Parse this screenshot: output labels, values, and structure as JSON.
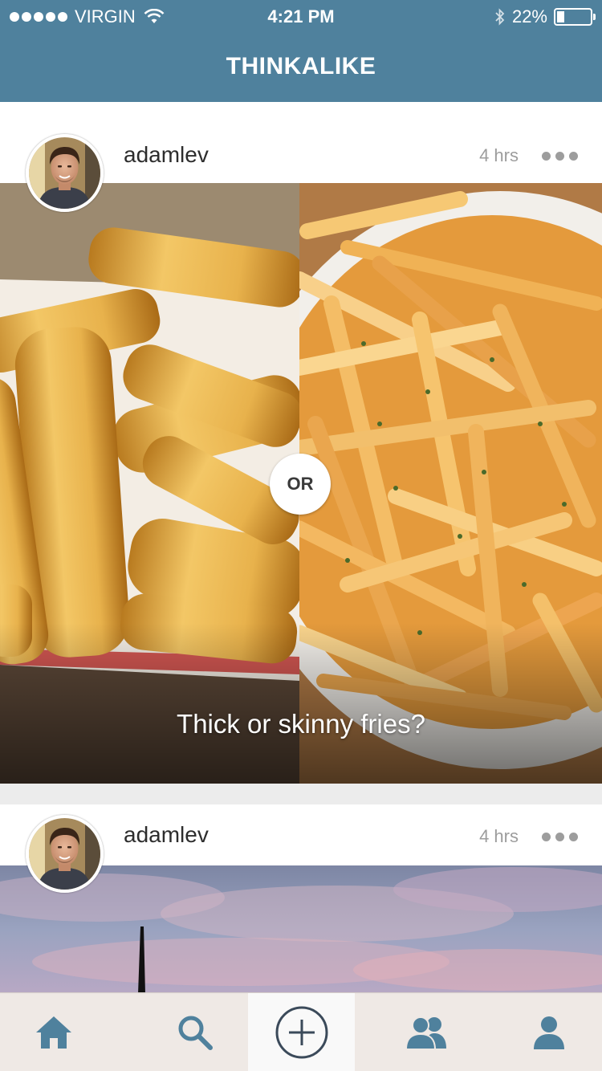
{
  "status_bar": {
    "carrier": "VIRGIN",
    "time": "4:21 PM",
    "battery": "22%",
    "battery_level": 0.22
  },
  "header": {
    "title": "THINKALIKE"
  },
  "posts": [
    {
      "username": "adamlev",
      "time_ago": "4 hrs",
      "or_label": "OR",
      "caption": "Thick or skinny fries?",
      "left_option": "thick fries image",
      "right_option": "skinny fries image"
    },
    {
      "username": "adamlev",
      "time_ago": "4 hrs"
    }
  ],
  "tabbar": {
    "tabs": [
      {
        "icon": "home-icon"
      },
      {
        "icon": "search-icon"
      },
      {
        "icon": "add-icon",
        "active": true
      },
      {
        "icon": "friends-icon"
      },
      {
        "icon": "profile-icon"
      }
    ],
    "accent_color": "#4f819d"
  },
  "colors": {
    "header_bg": "#4f819d",
    "username": "#2d2d2d",
    "meta": "#9d9d9d"
  }
}
